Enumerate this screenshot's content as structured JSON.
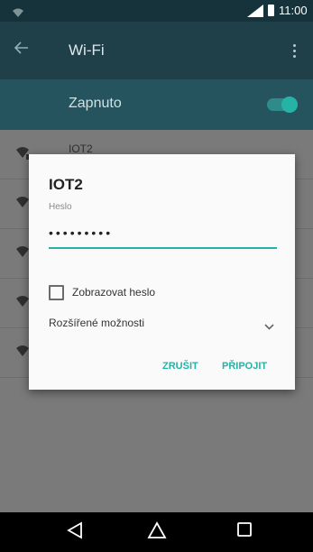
{
  "status_bar": {
    "time": "11:00",
    "icons": [
      "wifi-icon",
      "signal-icon",
      "battery-icon"
    ]
  },
  "app_bar": {
    "title": "Wi-Fi",
    "icons": [
      "back-arrow-icon",
      "more-vert-icon"
    ]
  },
  "wifi_switch": {
    "label": "Zapnuto",
    "on": true
  },
  "network_list": {
    "items": [
      {
        "name": "IOT2",
        "icon": "wifi-lock-icon"
      },
      {
        "name": "",
        "icon": "wifi-icon"
      },
      {
        "name": "",
        "icon": "wifi-icon"
      },
      {
        "name": "",
        "icon": "wifi-icon"
      },
      {
        "name": "",
        "icon": "wifi-icon"
      }
    ]
  },
  "dialog": {
    "title": "IOT2",
    "password_label": "Heslo",
    "password_value": "•••••••••",
    "show_password_label": "Zobrazovat heslo",
    "advanced_label": "Rozšířené možnosti",
    "cancel_label": "ZRUŠIT",
    "connect_label": "PŘIPOJIT"
  },
  "nav_bar": {
    "icons": [
      "back-triangle-icon",
      "home-icon",
      "recents-icon"
    ]
  },
  "colors": {
    "accent": "#26b3a6",
    "status_bar": "#16323a",
    "app_bar": "#1f4048",
    "switch_bar": "#25545e"
  }
}
